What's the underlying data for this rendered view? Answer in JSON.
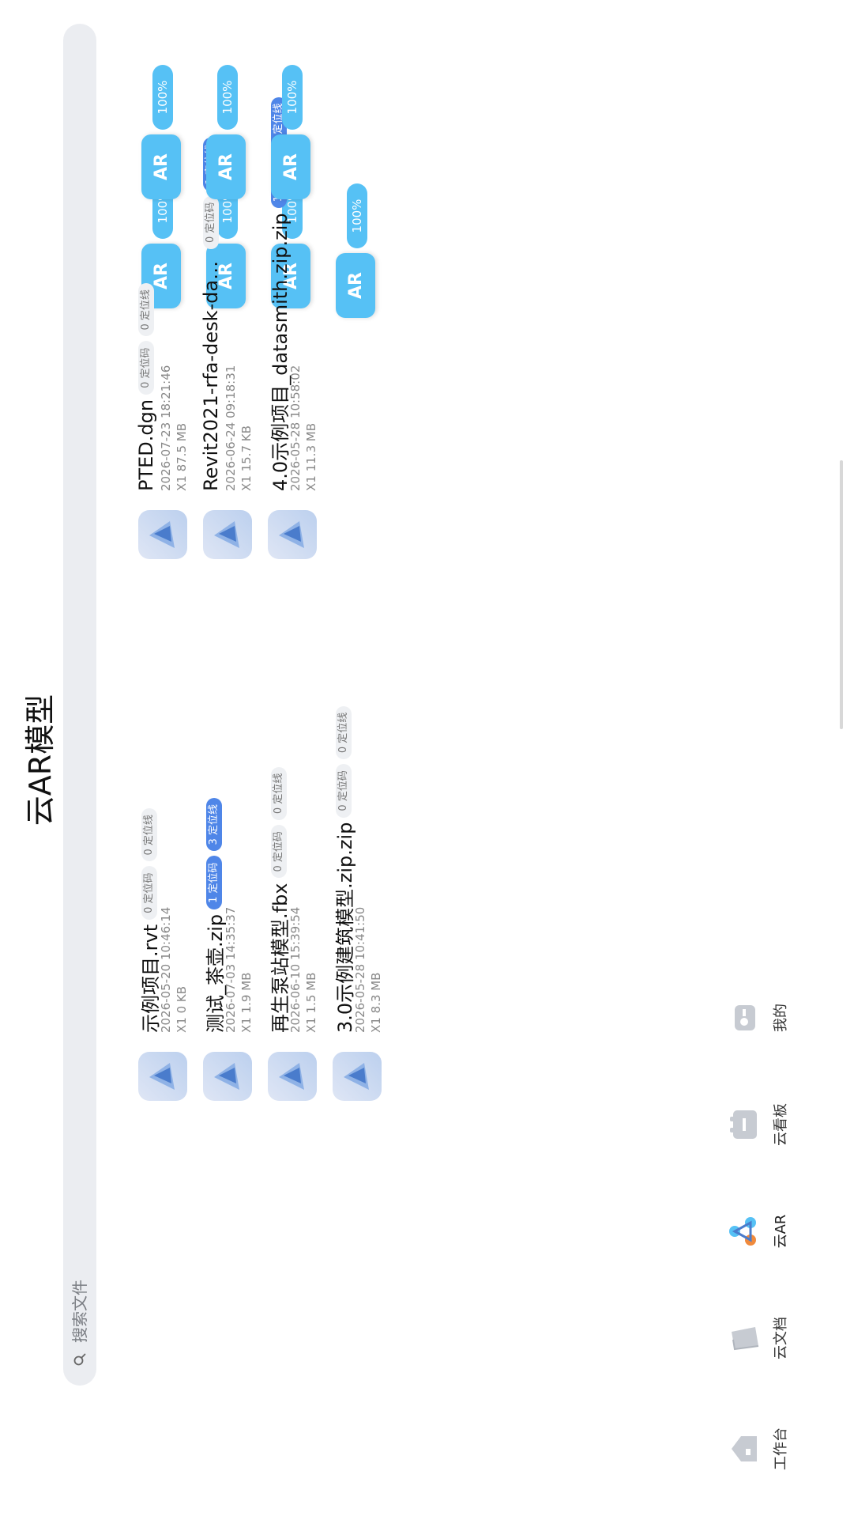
{
  "header": {
    "title": "云AR模型"
  },
  "search": {
    "placeholder": "搜索文件"
  },
  "ar_label": "AR",
  "files": [
    {
      "name": "示例项目.rvt",
      "date": "2026-05-20 10:46:14",
      "size": "X1  0 KB",
      "codes": "0 定位码",
      "lines": "0 定位线",
      "codes_blue": false,
      "lines_blue": false,
      "progress": "100%"
    },
    {
      "name": "测试_茶壶.zip",
      "date": "2026-07-03 14:35:37",
      "size": "X1  1.9 MB",
      "codes": "1 定位码",
      "lines": "3 定位线",
      "codes_blue": true,
      "lines_blue": true,
      "progress": "100%"
    },
    {
      "name": "再生泵站模型.fbx",
      "date": "2026-06-10 15:39:54",
      "size": "X1  1.5 MB",
      "codes": "0 定位码",
      "lines": "0 定位线",
      "codes_blue": false,
      "lines_blue": false,
      "progress": "100%"
    },
    {
      "name": "3.0示例建筑模型.zip.zip",
      "date": "2026-05-28 10:41:50",
      "size": "X1  8.3 MB",
      "codes": "0 定位码",
      "lines": "0 定位线",
      "codes_blue": false,
      "lines_blue": false,
      "progress": "100%"
    },
    {
      "name": "PTED.dgn",
      "date": "2026-07-23 18:21:46",
      "size": "X1  87.5 MB",
      "codes": "0 定位码",
      "lines": "0 定位线",
      "codes_blue": false,
      "lines_blue": false,
      "progress": "100%"
    },
    {
      "name": "Revit2021-rfa-desk-datasmith.…",
      "date": "2026-06-24 09:18:31",
      "size": "X1  15.7 KB",
      "codes": "0 定位码",
      "lines": "1 定位线",
      "codes_blue": false,
      "lines_blue": true,
      "progress": "100%"
    },
    {
      "name": "4.0示例项目_datasmith.zip.zip",
      "date": "2026-05-28 10:58:02",
      "size": "X1  11.3 MB",
      "codes": "1 定位码",
      "lines": "6 定位线",
      "codes_blue": true,
      "lines_blue": true,
      "progress": "100%"
    }
  ],
  "tabs": [
    {
      "label": "工作台",
      "icon": "workbench-icon",
      "active": false
    },
    {
      "label": "云文档",
      "icon": "documents-icon",
      "active": false
    },
    {
      "label": "云AR",
      "icon": "cloud-ar-icon",
      "active": true
    },
    {
      "label": "云看板",
      "icon": "dashboard-icon",
      "active": false
    },
    {
      "label": "我的",
      "icon": "profile-icon",
      "active": false
    }
  ],
  "colors": {
    "accent": "#56c1f5",
    "badge_blue": "#4f86e8",
    "search_bg": "#ebedf1"
  }
}
